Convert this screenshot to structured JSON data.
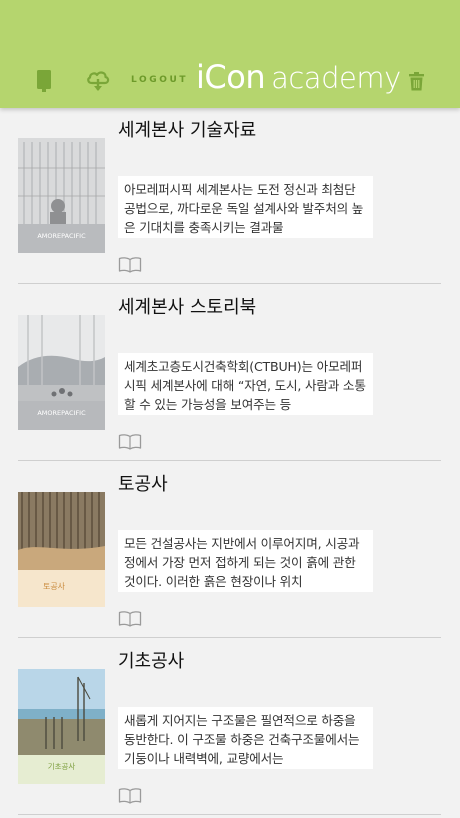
{
  "header": {
    "logout_label": "LOGOUT",
    "brand_icon": "iCon",
    "brand_academy": "academy",
    "icons": [
      "tablet-icon",
      "cloud-download-icon",
      "trash-icon"
    ],
    "colors": {
      "bar": "#b5d56e",
      "accent": "#6d9a2a",
      "icon": "#7aa638"
    }
  },
  "books": [
    {
      "title": "세계본사 기술자료",
      "description": "아모레퍼시픽 세계본사는 도전 정신과 최첨단 공법으로, 까다로운 독일 설계사와 발주처의 높은 기대치를 충족시키는 결과물",
      "thumb_label": "AMOREPACIFIC"
    },
    {
      "title": "세계본사 스토리북",
      "description": "세계초고층도시건축학회(CTBUH)는 아모레퍼시픽 세계본사에 대해 “자연, 도시, 사람과 소통할 수 있는 가능성을 보여주는 등",
      "thumb_label": "AMOREPACIFIC"
    },
    {
      "title": "토공사",
      "description": "모든 건설공사는 지반에서 이루어지며, 시공과정에서 가장 먼저 접하게 되는 것이 흙에 관한 것이다. 이러한 흙은 현장이나 위치",
      "thumb_label": "토공사"
    },
    {
      "title": "기초공사",
      "description": "새롭게 지어지는 구조물은 필연적으로 하중을 동반한다. 이 구조물 하중은 건축구조물에서는 기둥이나 내력벽에, 교량에서는",
      "thumb_label": "기초공사"
    }
  ]
}
